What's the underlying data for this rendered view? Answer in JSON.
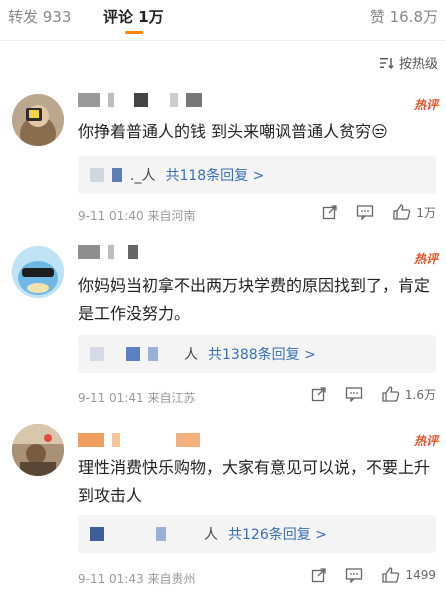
{
  "tabs": {
    "repost": "转发 933",
    "comments": "评论 1万",
    "likes": "赞 16.8万"
  },
  "sort": {
    "label": "按热级"
  },
  "comments": [
    {
      "text": "你挣着普通人的钱 到头来嘲讽普通人贫穷😒",
      "hot": "热评",
      "reply_name": "._人",
      "reply_link": "共118条回复 >",
      "time": "9-11 01:40 来自河南",
      "like_count": "1万"
    },
    {
      "text": "你妈妈当初拿不出两万块学费的原因找到了，肯定是工作没努力。",
      "hot": "热评",
      "reply_name": "人",
      "reply_link": "共1388条回复 >",
      "time": "9-11 01:41 来自江苏",
      "like_count": "1.6万"
    },
    {
      "text": "理性消费快乐购物，大家有意见可以说，不要上升到攻击人",
      "hot": "热评",
      "reply_name": "人",
      "reply_link": "共126条回复 >",
      "time": "9-11 01:43 来自贵州",
      "like_count": "1499"
    }
  ],
  "icons": {
    "sort": "sort-icon",
    "share": "share-icon",
    "comment": "comment-icon",
    "like": "thumbs-up-icon"
  },
  "colors": {
    "accent": "#ff8200",
    "hot": "#e5532b",
    "link": "#3a6fb5"
  }
}
